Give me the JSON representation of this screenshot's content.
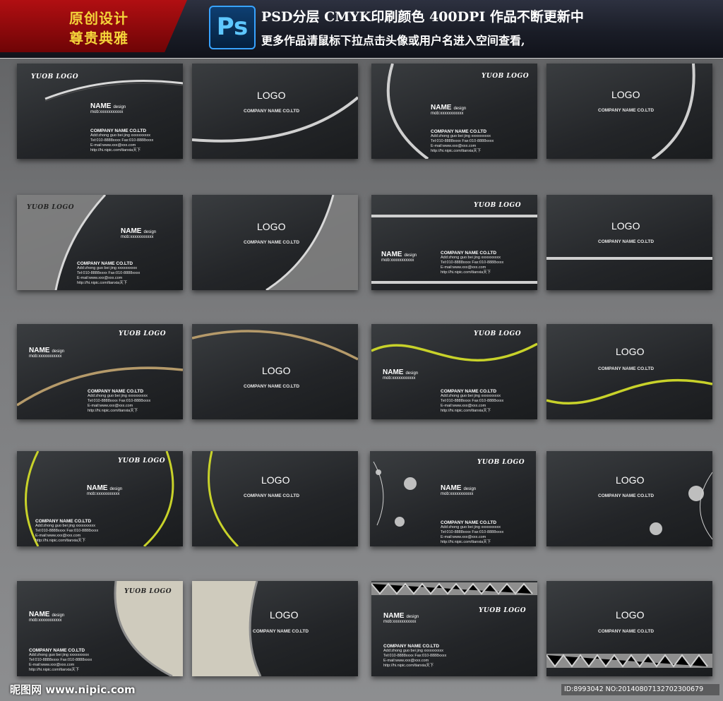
{
  "header": {
    "badge_line1": "原创设计",
    "badge_line2": "尊贵典雅",
    "ps_icon": "Ps",
    "line1": "PSD分层 CMYK印刷颜色 400DPI 作品不断更新中",
    "line2": "更多作品请鼠标下拉点击头像或用户名进入空间查看,"
  },
  "front": {
    "logo": "YUOB LOGO",
    "name": "NAME",
    "design": "design",
    "mob": "mob:xxxxxxxxxxx",
    "company": "COMPANY NAME CO.LTD",
    "add": "Add:zhong guo bei jing xxxxxxxxxx",
    "tel": "Tel:010-8888xxxx Fax:010-8888xxxx",
    "email": "E-mail:www.xxx@xxx.com",
    "web": "http://hi.nipic.com/tianxia天下"
  },
  "back": {
    "logo": "LOGO",
    "company": "COMPANY NAME CO.LTD"
  },
  "footer": {
    "watermark": "昵图网 www.nipic.com",
    "id": "ID:8993042 NO:20140807132702300679"
  },
  "colors": {
    "silver": "#c8c8c8",
    "gold": "#b59a6a",
    "lime": "#c8d22a",
    "badge_red": "#a50d10",
    "badge_text": "#f4d43a",
    "header_bg": "#1a1d27"
  }
}
